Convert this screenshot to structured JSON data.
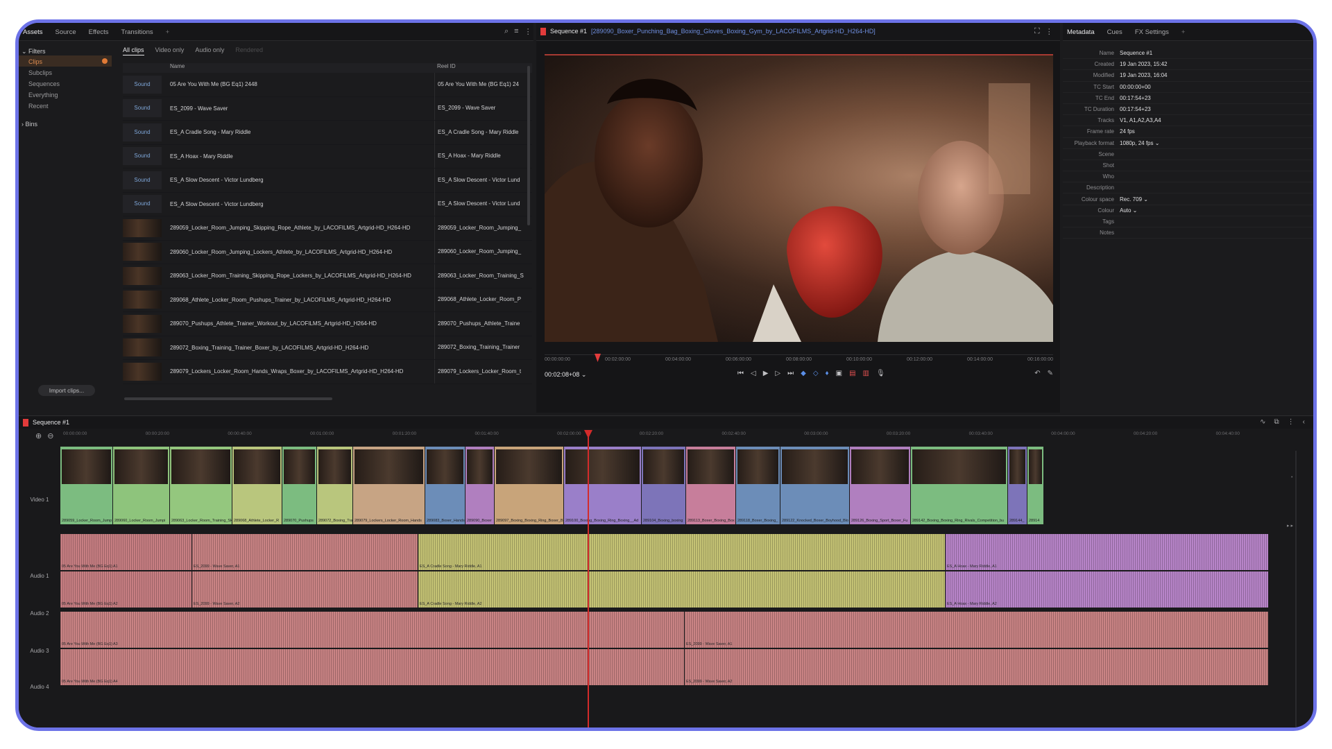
{
  "assets_panel": {
    "tabs": [
      "Assets",
      "Source",
      "Effects",
      "Transitions",
      "+"
    ],
    "filters_header": "Filters",
    "filter_items": [
      "Clips",
      "Subclips",
      "Sequences",
      "Everything",
      "Recent"
    ],
    "bins_label": "Bins",
    "import_label": "Import clips...",
    "clip_tabs": [
      "All clips",
      "Video only",
      "Audio only",
      "Rendered"
    ],
    "columns": {
      "name": "Name",
      "reel": "Reel ID"
    },
    "rows": [
      {
        "kind": "Sound",
        "name": "05 Are You With Me (BG Eq1) 2448",
        "reel": "05 Are You With Me (BG Eq1) 24"
      },
      {
        "kind": "Sound",
        "name": "ES_2099 - Wave Saver",
        "reel": "ES_2099 - Wave Saver"
      },
      {
        "kind": "Sound",
        "name": "ES_A Cradle Song - Mary Riddle",
        "reel": "ES_A Cradle Song - Mary Riddle"
      },
      {
        "kind": "Sound",
        "name": "ES_A Hoax - Mary Riddle",
        "reel": "ES_A Hoax - Mary Riddle"
      },
      {
        "kind": "Sound",
        "name": "ES_A Slow Descent - Victor Lundberg",
        "reel": "ES_A Slow Descent - Victor Lund"
      },
      {
        "kind": "Sound",
        "name": "ES_A Slow Descent - Victor Lundberg",
        "reel": "ES_A Slow Descent - Victor Lund"
      },
      {
        "kind": "",
        "name": "289059_Locker_Room_Jumping_Skipping_Rope_Athlete_by_LACOFILMS_Artgrid-HD_H264-HD",
        "reel": "289059_Locker_Room_Jumping_"
      },
      {
        "kind": "",
        "name": "289060_Locker_Room_Jumping_Lockers_Athlete_by_LACOFILMS_Artgrid-HD_H264-HD",
        "reel": "289060_Locker_Room_Jumping_"
      },
      {
        "kind": "",
        "name": "289063_Locker_Room_Training_Skipping_Rope_Lockers_by_LACOFILMS_Artgrid-HD_H264-HD",
        "reel": "289063_Locker_Room_Training_S"
      },
      {
        "kind": "",
        "name": "289068_Athlete_Locker_Room_Pushups_Trainer_by_LACOFILMS_Artgrid-HD_H264-HD",
        "reel": "289068_Athlete_Locker_Room_P"
      },
      {
        "kind": "",
        "name": "289070_Pushups_Athlete_Trainer_Workout_by_LACOFILMS_Artgrid-HD_H264-HD",
        "reel": "289070_Pushups_Athlete_Traine"
      },
      {
        "kind": "",
        "name": "289072_Boxing_Training_Trainer_Boxer_by_LACOFILMS_Artgrid-HD_H264-HD",
        "reel": "289072_Boxing_Training_Trainer"
      },
      {
        "kind": "",
        "name": "289079_Lockers_Locker_Room_Hands_Wraps_Boxer_by_LACOFILMS_Artgrid-HD_H264-HD",
        "reel": "289079_Lockers_Locker_Room_t"
      }
    ]
  },
  "viewer": {
    "sequence": "Sequence #1",
    "path": "[289090_Boxer_Punching_Bag_Boxing_Gloves_Boxing_Gym_by_LACOFILMS_Artgrid-HD_H264-HD]",
    "ruler": [
      "00:00:00:00",
      "00:02:00:00",
      "00:04:00:00",
      "00:06:00:00",
      "00:08:00:00",
      "00:10:00:00",
      "00:12:00:00",
      "00:14:00:00",
      "00:16:00:00"
    ],
    "timecode": "00:02:08+08"
  },
  "metadata": {
    "tabs": [
      "Metadata",
      "Cues",
      "FX Settings",
      "+"
    ],
    "rows": [
      {
        "k": "Name",
        "v": "Sequence #1"
      },
      {
        "k": "Created",
        "v": "19 Jan 2023, 15:42"
      },
      {
        "k": "Modified",
        "v": "19 Jan 2023, 16:04"
      },
      {
        "k": "TC Start",
        "v": "00:00:00+00"
      },
      {
        "k": "TC End",
        "v": "00:17:54+23"
      },
      {
        "k": "TC Duration",
        "v": "00:17:54+23"
      },
      {
        "k": "Tracks",
        "v": "V1, A1,A2,A3,A4"
      },
      {
        "k": "Frame rate",
        "v": "24 fps"
      },
      {
        "k": "Playback format",
        "v": "1080p, 24 fps ⌄"
      },
      {
        "k": "Scene",
        "v": ""
      },
      {
        "k": "Shot",
        "v": ""
      },
      {
        "k": "Who",
        "v": ""
      },
      {
        "k": "Description",
        "v": ""
      },
      {
        "k": "Colour space",
        "v": "Rec. 709 ⌄"
      },
      {
        "k": "Colour",
        "v": "Auto ⌄"
      },
      {
        "k": "Tags",
        "v": ""
      },
      {
        "k": "Notes",
        "v": ""
      }
    ]
  },
  "timeline": {
    "sequence": "Sequence #1",
    "ruler": [
      "00:00:00:00",
      "00:00:20:00",
      "00:00:40:00",
      "00:01:00:00",
      "00:01:20:00",
      "00:01:40:00",
      "00:02:00:00",
      "00:02:20:00",
      "00:02:40:00",
      "00:03:00:00",
      "00:03:20:00",
      "00:03:40:00",
      "00:04:00:00",
      "00:04:20:00",
      "00:04:40:00"
    ],
    "tracks": [
      "Video 1",
      "Audio 1",
      "Audio 2",
      "Audio 3",
      "Audio 4"
    ],
    "video_clips": [
      {
        "cap": "289059_Locker_Room_Jump",
        "color": "#7cbc80"
      },
      {
        "cap": "289060_Locker_Room_Jumpi",
        "color": "#8ec47c"
      },
      {
        "cap": "289063_Locker_Room_Training_Sk",
        "color": "#94c77e"
      },
      {
        "cap": "289068_Athlete_Locker_R",
        "color": "#b9c67d"
      },
      {
        "cap": "289070_Pushups",
        "color": "#7cbc80"
      },
      {
        "cap": "289072_Boxing_Tra",
        "color": "#b9c67d"
      },
      {
        "cap": "289079_Lockers_Locker_Room_Hands",
        "color": "#c7a484"
      },
      {
        "cap": "289083_Boxer_Hands",
        "color": "#6c8db8"
      },
      {
        "cap": "289090_Boxer",
        "color": "#b07fbf"
      },
      {
        "cap": "289097_Boxing_Boxing_Ring_Boxer_B",
        "color": "#c8a47a"
      },
      {
        "cap": "289100_Boxing_Boxing_Ring_Boxing__Ad",
        "color": "#9a7fc9"
      },
      {
        "cap": "289104_Boxing_boxing",
        "color": "#7d74b9"
      },
      {
        "cap": "289113_Boxer_Boxing_Box",
        "color": "#c77e9b"
      },
      {
        "cap": "289118_Boxer_Boxing_",
        "color": "#6c8db8"
      },
      {
        "cap": "289122_Knocked_Boxer_Boyhood_Blo",
        "color": "#6c8db8"
      },
      {
        "cap": "289126_Boxing_Sport_Boxer_Fu",
        "color": "#b07fbf"
      },
      {
        "cap": "289142_Boxing_Boxing_Ring_Rivals_Competition_bu",
        "color": "#7cbc80"
      },
      {
        "cap": "289144_",
        "color": "#7d74b9"
      },
      {
        "cap": "28914",
        "color": "#7cbc80"
      }
    ],
    "audio12": [
      {
        "cap1": "05 Are You With Me (BG Eq1) A1",
        "cap2": "05 Are You With Me (BG Eq1) A2",
        "color": "#c77e82"
      },
      {
        "cap1": "ES_2099 - Wave Saver, A1",
        "cap2": "ES_2099 - Wave Saver, A2",
        "color": "#c98384"
      },
      {
        "cap1": "ES_A Cradle Song - Mary Riddle, A1",
        "cap2": "ES_A Cradle Song - Mary Riddle, A2",
        "color": "#c4c274"
      },
      {
        "cap1": "ES_A Hoax - Mary Riddle, A1",
        "cap2": "ES_A Hoax - Mary Riddle, A2",
        "color": "#b784c8"
      }
    ],
    "audio34": [
      {
        "cap1": "05 Are You With Me (BG Eq1) A3",
        "cap2": "05 Are You With Me (BG Eq1) A4",
        "color": "#c98384"
      },
      {
        "cap1": "ES_2099 - Wave Saver, A1",
        "cap2": "ES_2099 - Wave Saver, A2",
        "color": "#c98384"
      }
    ]
  }
}
